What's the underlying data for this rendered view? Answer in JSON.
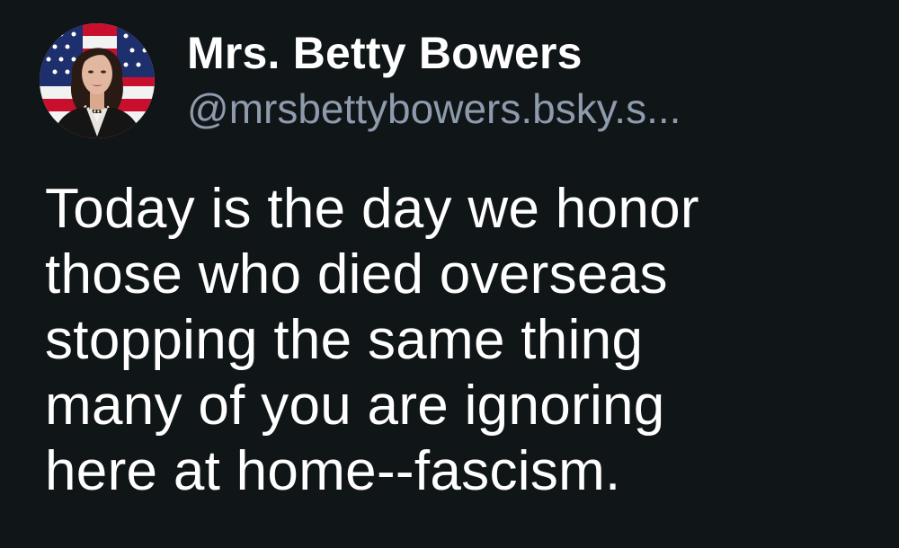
{
  "author": {
    "display_name": "Mrs. Betty Bowers",
    "handle": "@mrsbettybowers.bsky.s...",
    "avatar_icon": "profile-photo-avatar-with-flag"
  },
  "post": {
    "lines": [
      "Today is the day we honor",
      "those who died overseas",
      "stopping the same thing",
      "many of you are ignoring",
      "here at home--fascism."
    ]
  },
  "colors": {
    "background": "#101617",
    "text_primary": "#ffffff",
    "text_handle": "#8e9bad"
  }
}
